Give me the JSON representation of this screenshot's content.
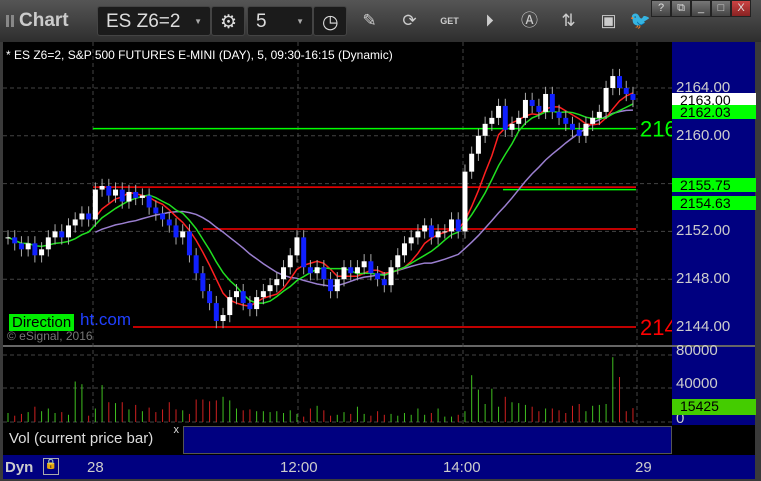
{
  "window": {
    "title": "Chart",
    "symbol": "ES Z6=2",
    "interval": "5",
    "controls": [
      "?",
      "restore",
      "minimize",
      "maximize",
      "X"
    ]
  },
  "toolbar_icons": [
    "settings-icon",
    "clock-icon",
    "pencil-icon",
    "refresh-icon",
    "get-icon",
    "play-icon",
    "alert-icon",
    "link-icon",
    "comment-icon",
    "twitter-icon"
  ],
  "chart": {
    "info": "* ES Z6=2, S&P 500 FUTURES E-MINI (DAY), 5, 09:30-16:15 (Dynamic)",
    "watermark_label": "Direction",
    "watermark_rest": "ht.com",
    "copyright": "© eSignal, 2016",
    "price_ticks": [
      "2164.00",
      "2160.00",
      "2152.00",
      "2148.00",
      "2144.00"
    ],
    "markers": [
      {
        "text": "2163.00",
        "color": "#ffffff",
        "value": 2163.0
      },
      {
        "text": "2162.03",
        "color": "#00ff00",
        "value": 2162.03
      },
      {
        "text": "2155.75",
        "color": "#00ff00",
        "value": 2155.75
      },
      {
        "text": "2154.63",
        "color": "#00ff00",
        "value": 2154.63
      }
    ],
    "levels": [
      {
        "value": 2160.6,
        "color": "#00ff00",
        "label": "216"
      },
      {
        "value": 2155.7,
        "color": "#ff0000",
        "label": ""
      },
      {
        "value": 2155.5,
        "color": "#00ff00",
        "label": ""
      },
      {
        "value": 2152.2,
        "color": "#ff0000",
        "label": ""
      },
      {
        "value": 2144.0,
        "color": "#ff0000",
        "label": "214"
      }
    ],
    "vol_ticks": [
      "80000",
      "40000",
      "0"
    ],
    "vol_marker": "15425",
    "vol_legend": "Vol (current price bar)",
    "close_x": "x",
    "time_labels": [
      "28",
      "12:00",
      "14:00",
      "29"
    ],
    "dyn": "Dyn"
  },
  "chart_data": {
    "type": "candlestick",
    "ylim": [
      2142.5,
      2167
    ],
    "vol_ylim": [
      0,
      80000
    ],
    "closes": [
      2151.5,
      2151,
      2150.5,
      2151,
      2150,
      2150.5,
      2151.5,
      2152,
      2151.5,
      2152.5,
      2153,
      2153.5,
      2153,
      2155.5,
      2155.8,
      2155,
      2155.5,
      2154.5,
      2155.3,
      2154.8,
      2155,
      2154,
      2153.5,
      2153,
      2152.5,
      2151.5,
      2152,
      2150,
      2148.5,
      2147,
      2146,
      2144.5,
      2145,
      2146.5,
      2147,
      2146,
      2145.5,
      2146.5,
      2147,
      2147.5,
      2148,
      2149,
      2150,
      2151.5,
      2149,
      2148.5,
      2149,
      2148,
      2147,
      2148,
      2149,
      2148.5,
      2149,
      2149.5,
      2148.5,
      2148,
      2147.5,
      2149,
      2150,
      2151,
      2151.5,
      2152,
      2152.5,
      2151.5,
      2152,
      2152,
      2153,
      2152,
      2157,
      2158.5,
      2160,
      2161,
      2161.5,
      2162.5,
      2160.5,
      2161,
      2161.5,
      2163,
      2162.5,
      2162,
      2163.5,
      2162,
      2161.5,
      2161,
      2160.5,
      2160,
      2161,
      2161.5,
      2162,
      2164,
      2165,
      2164,
      2163.5,
      2163
    ],
    "volume": [
      10000,
      7000,
      9000,
      11000,
      17000,
      12000,
      15000,
      10000,
      11000,
      8000,
      45000,
      42000,
      7000,
      15000,
      41000,
      22000,
      21000,
      22000,
      14000,
      19000,
      12000,
      16000,
      11000,
      14000,
      22000,
      14000,
      13000,
      9000,
      25000,
      25000,
      23000,
      24000,
      28000,
      24000,
      15000,
      13000,
      14000,
      12000,
      12000,
      11000,
      12000,
      10000,
      13000,
      9000,
      6000,
      15000,
      18000,
      13000,
      7000,
      8000,
      11000,
      9000,
      17000,
      9000,
      7000,
      12000,
      8000,
      9000,
      7000,
      10000,
      8000,
      15000,
      8000,
      10000,
      15000,
      6000,
      6000,
      8000,
      12000,
      52000,
      36000,
      20000,
      37000,
      17000,
      28000,
      22000,
      21000,
      19000,
      17000,
      12000,
      15000,
      15000,
      13000,
      10000,
      18000,
      20000,
      12000,
      18000,
      19000,
      20000,
      72000,
      50000,
      12000,
      15425
    ]
  }
}
